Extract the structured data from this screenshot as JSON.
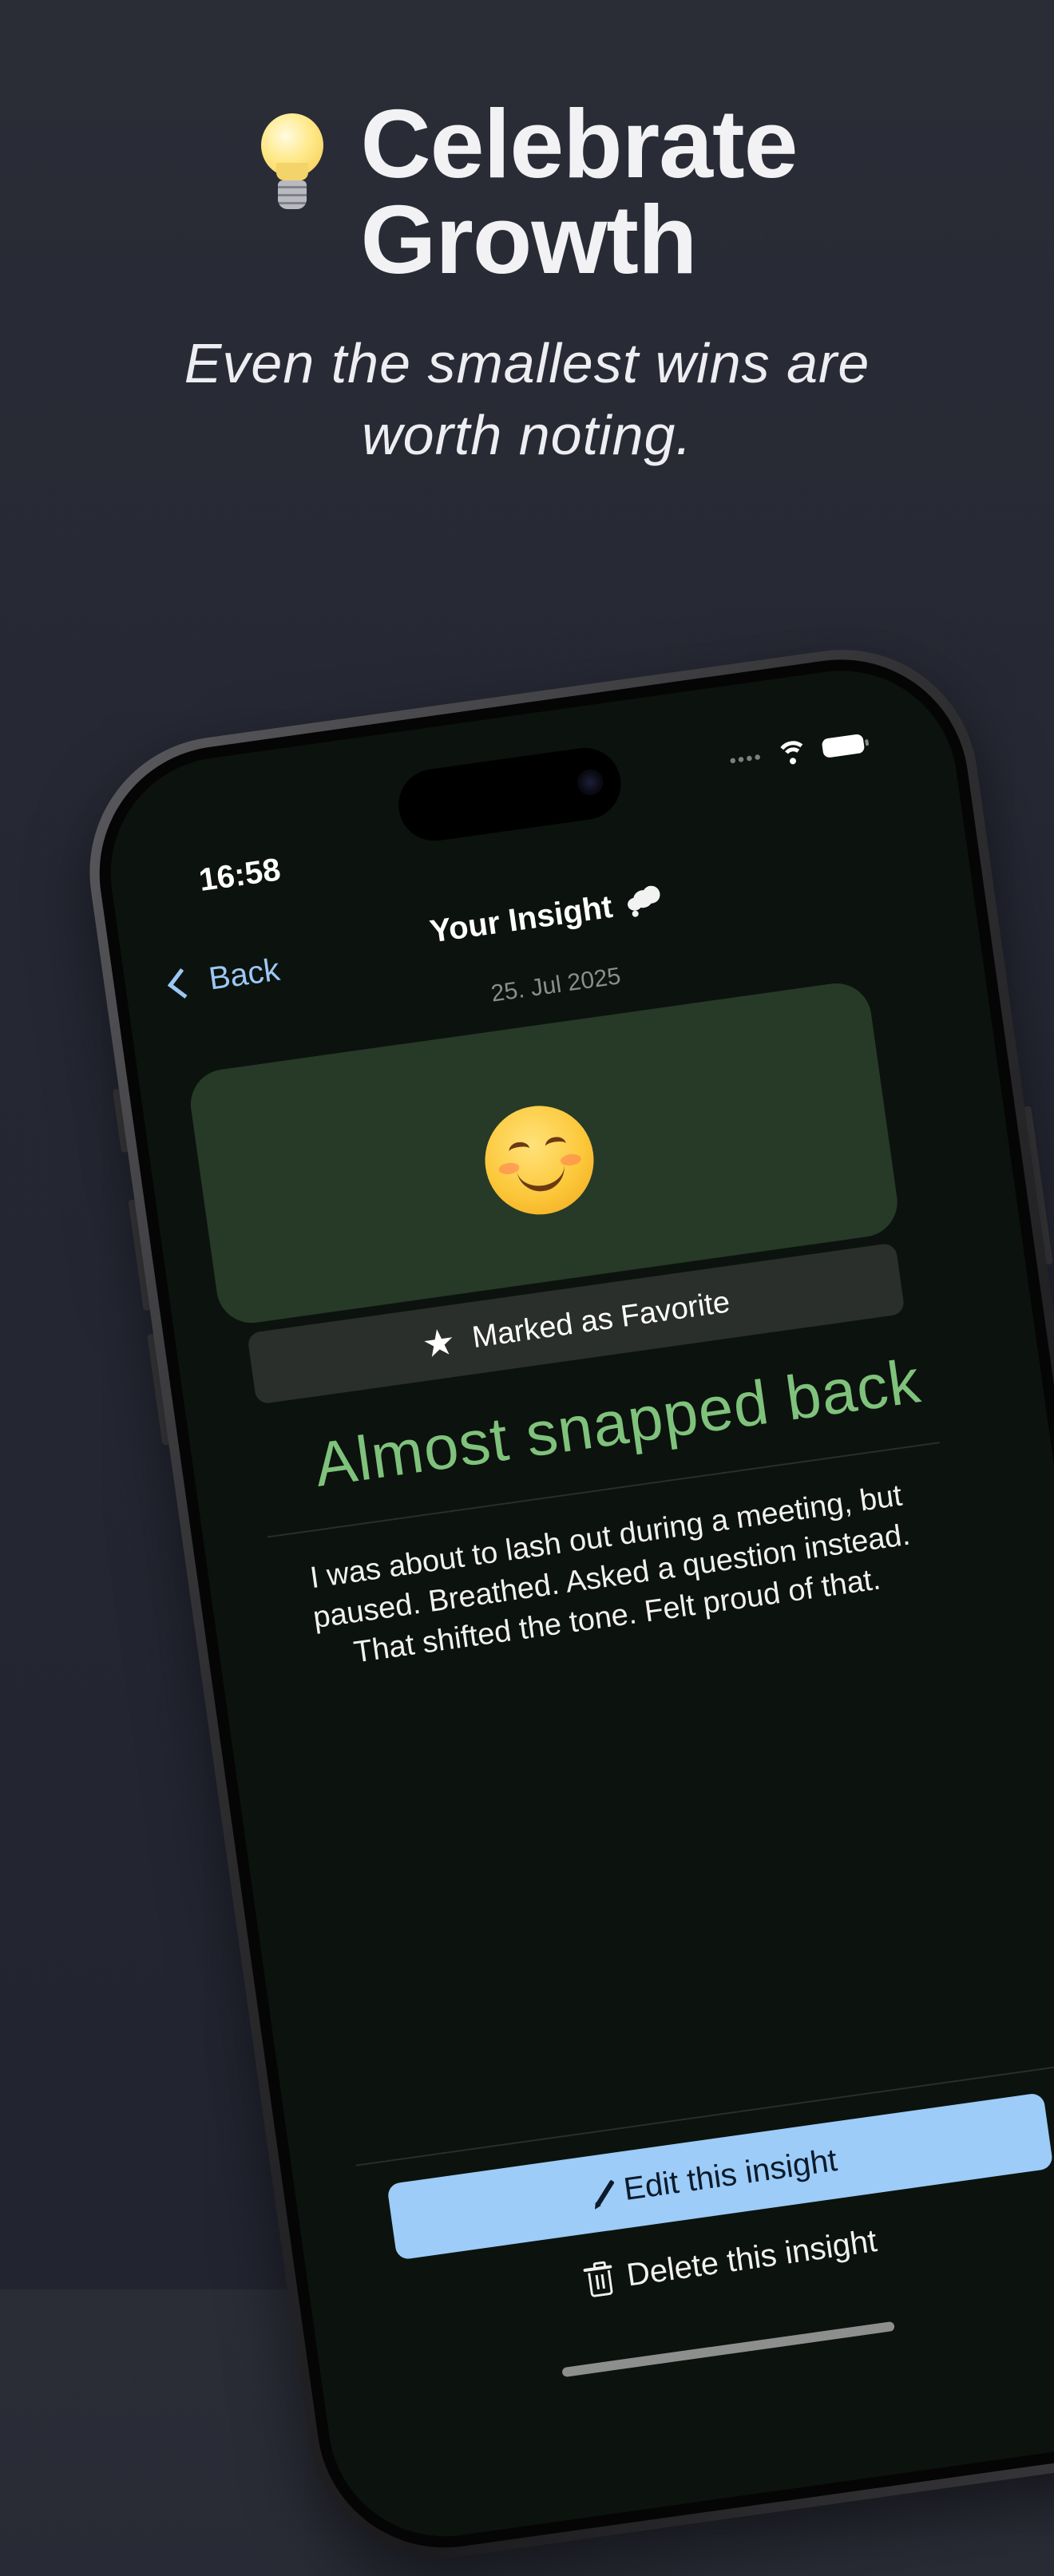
{
  "hero": {
    "icon": "lightbulb-icon",
    "title_line1": "Celebrate",
    "title_line2": "Growth",
    "subtitle_line1": "Even the smallest wins are",
    "subtitle_line2": "worth noting."
  },
  "status_bar": {
    "time": "16:58",
    "icons": [
      "cellular-dots-icon",
      "wifi-icon",
      "battery-icon"
    ]
  },
  "nav": {
    "back_label": "Back",
    "title": "Your Insight",
    "title_icon": "thought-bubble-icon"
  },
  "insight": {
    "date": "25. Jul 2025",
    "emoji_icon": "smiling-face-icon",
    "favorite_label": "Marked as Favorite",
    "favorite_icon": "star-icon",
    "title": "Almost snapped back",
    "body": "I was about to lash out during a meeting, but paused. Breathed. Asked a question instead. That shifted the tone. Felt proud of that."
  },
  "actions": {
    "edit_label": "Edit this insight",
    "delete_label": "Delete this insight"
  },
  "colors": {
    "background": "#252733",
    "screen_background": "#0c120d",
    "emoji_card": "#263a27",
    "title_green": "#7fc27c",
    "accent_blue": "#9cccf7",
    "back_blue": "#9bc8f5"
  }
}
